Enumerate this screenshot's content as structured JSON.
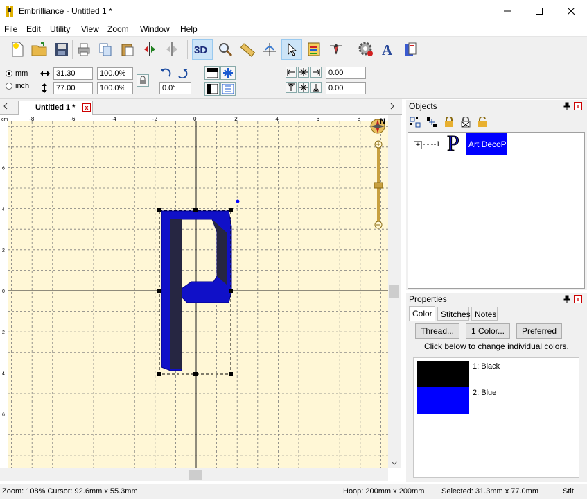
{
  "window": {
    "title": "Embrilliance -  Untitled 1 *"
  },
  "menu": [
    "File",
    "Edit",
    "Utility",
    "View",
    "Zoom",
    "Window",
    "Help"
  ],
  "toolbar2": {
    "unit_mm": "mm",
    "unit_inch": "inch",
    "width": "31.30",
    "height": "77.00",
    "width_pct": "100.0%",
    "height_pct": "100.0%",
    "rotation": "0.0°",
    "x_offset": "0.00",
    "y_offset": "0.00"
  },
  "document_tab": {
    "label": "Untitled 1 *"
  },
  "ruler": {
    "unit": "cm",
    "labels": [
      "-8",
      "-6",
      "-4",
      "-2",
      "0",
      "2",
      "4",
      "6",
      "8"
    ],
    "v_labels": [
      "6",
      "4",
      "2",
      "0",
      "2",
      "4",
      "6"
    ]
  },
  "compass": "N",
  "objects_panel": {
    "title": "Objects",
    "item_index": "1",
    "item_label": "Art DecoP",
    "item_glyph": "P"
  },
  "properties_panel": {
    "title": "Properties",
    "tabs": [
      "Color",
      "Stitches",
      "Notes"
    ],
    "buttons": {
      "thread": "Thread...",
      "one_color": "1 Color...",
      "preferred": "Preferred"
    },
    "hint": "Click below to change individual colors.",
    "colors": [
      {
        "label": "1: Black",
        "hex": "#000000"
      },
      {
        "label": "2: Blue",
        "hex": "#0000ff"
      }
    ]
  },
  "design": {
    "letter": "P",
    "fill": "#1010c8",
    "shade": "#2a2a2a"
  },
  "status": {
    "zoom": "Zoom: 108%  Cursor: 92.6mm x 55.3mm",
    "hoop": "Hoop: 200mm x 200mm",
    "selected": "Selected: 31.3mm x 77.0mm",
    "extra": "Stit"
  },
  "colors": {
    "canvas": "#fff7d6",
    "grid": "#7a7a7a",
    "selection": "#0000ff",
    "accent": "#0078d7"
  }
}
